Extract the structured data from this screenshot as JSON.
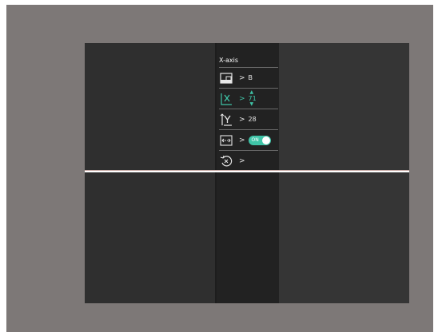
{
  "menu": {
    "title": "X-axis",
    "items": [
      {
        "name": "mode",
        "icon": "screen-mode-icon",
        "arrow": ">",
        "value": "B"
      },
      {
        "name": "x-axis",
        "icon": "x-axis-icon",
        "arrow": ">",
        "value": "71",
        "active": true
      },
      {
        "name": "y-axis",
        "icon": "y-axis-icon",
        "arrow": ">",
        "value": "28"
      },
      {
        "name": "horizontal",
        "icon": "horizontal-arrows-icon",
        "arrow": ">",
        "toggle_label": "ON",
        "toggle_on": true
      },
      {
        "name": "reset",
        "icon": "reset-icon",
        "arrow": ">"
      }
    ]
  },
  "colors": {
    "accent": "#3fc4a7",
    "background": "#7d7877",
    "viewport": "#2b2b2b",
    "line": "#ffffff"
  }
}
